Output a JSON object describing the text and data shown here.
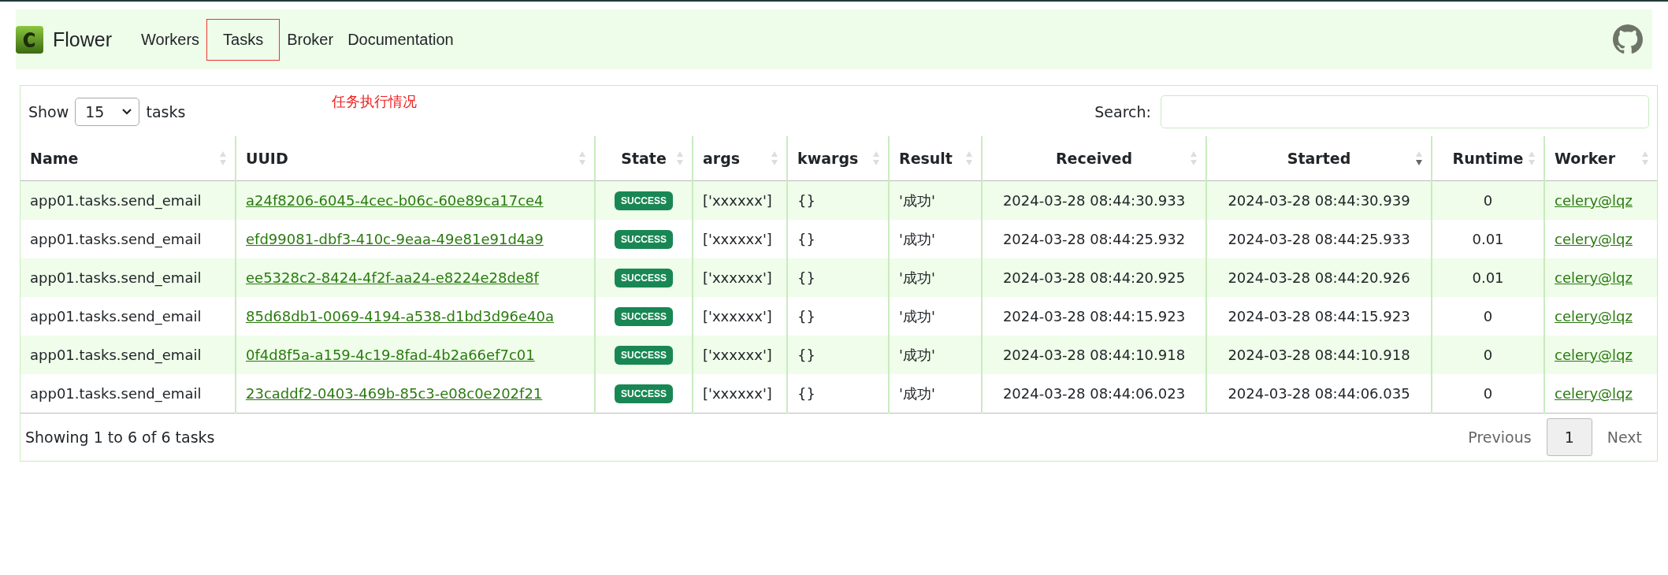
{
  "navbar": {
    "brand": "Flower",
    "items": [
      {
        "label": "Workers",
        "highlighted": false
      },
      {
        "label": "Tasks",
        "highlighted": true
      },
      {
        "label": "Broker",
        "highlighted": false
      },
      {
        "label": "Documentation",
        "highlighted": false
      }
    ]
  },
  "annotation": "任务执行情况",
  "controls": {
    "show_label": "Show",
    "page_size": "15",
    "unit_label": "tasks",
    "search_label": "Search:"
  },
  "table": {
    "columns": [
      {
        "label": "Name",
        "sorted_descending": false
      },
      {
        "label": "UUID",
        "sorted_descending": false
      },
      {
        "label": "State",
        "sorted_descending": false
      },
      {
        "label": "args",
        "sorted_descending": false
      },
      {
        "label": "kwargs",
        "sorted_descending": false
      },
      {
        "label": "Result",
        "sorted_descending": false
      },
      {
        "label": "Received",
        "sorted_descending": false
      },
      {
        "label": "Started",
        "sorted_descending": true
      },
      {
        "label": "Runtime",
        "sorted_descending": false
      },
      {
        "label": "Worker",
        "sorted_descending": false
      }
    ],
    "rows": [
      {
        "name": "app01.tasks.send_email",
        "uuid": "a24f8206-6045-4cec-b06c-60e89ca17ce4",
        "state": "SUCCESS",
        "args": "['xxxxxx']",
        "kwargs": "{}",
        "result": "'成功'",
        "received": "2024-03-28 08:44:30.933",
        "started": "2024-03-28 08:44:30.939",
        "runtime": "0",
        "worker": "celery@lqz"
      },
      {
        "name": "app01.tasks.send_email",
        "uuid": "efd99081-dbf3-410c-9eaa-49e81e91d4a9",
        "state": "SUCCESS",
        "args": "['xxxxxx']",
        "kwargs": "{}",
        "result": "'成功'",
        "received": "2024-03-28 08:44:25.932",
        "started": "2024-03-28 08:44:25.933",
        "runtime": "0.01",
        "worker": "celery@lqz"
      },
      {
        "name": "app01.tasks.send_email",
        "uuid": "ee5328c2-8424-4f2f-aa24-e8224e28de8f",
        "state": "SUCCESS",
        "args": "['xxxxxx']",
        "kwargs": "{}",
        "result": "'成功'",
        "received": "2024-03-28 08:44:20.925",
        "started": "2024-03-28 08:44:20.926",
        "runtime": "0.01",
        "worker": "celery@lqz"
      },
      {
        "name": "app01.tasks.send_email",
        "uuid": "85d68db1-0069-4194-a538-d1bd3d96e40a",
        "state": "SUCCESS",
        "args": "['xxxxxx']",
        "kwargs": "{}",
        "result": "'成功'",
        "received": "2024-03-28 08:44:15.923",
        "started": "2024-03-28 08:44:15.923",
        "runtime": "0",
        "worker": "celery@lqz"
      },
      {
        "name": "app01.tasks.send_email",
        "uuid": "0f4d8f5a-a159-4c19-8fad-4b2a66ef7c01",
        "state": "SUCCESS",
        "args": "['xxxxxx']",
        "kwargs": "{}",
        "result": "'成功'",
        "received": "2024-03-28 08:44:10.918",
        "started": "2024-03-28 08:44:10.918",
        "runtime": "0",
        "worker": "celery@lqz"
      },
      {
        "name": "app01.tasks.send_email",
        "uuid": "23caddf2-0403-469b-85c3-e08c0e202f21",
        "state": "SUCCESS",
        "args": "['xxxxxx']",
        "kwargs": "{}",
        "result": "'成功'",
        "received": "2024-03-28 08:44:06.023",
        "started": "2024-03-28 08:44:06.035",
        "runtime": "0",
        "worker": "celery@lqz"
      }
    ]
  },
  "footer": {
    "info": "Showing 1 to 6 of 6 tasks",
    "pages": [
      {
        "label": "Previous",
        "kind": "nav",
        "disabled": true,
        "selected": false
      },
      {
        "label": "1",
        "kind": "page",
        "disabled": false,
        "selected": true
      },
      {
        "label": "Next",
        "kind": "nav",
        "disabled": true,
        "selected": false
      }
    ]
  }
}
